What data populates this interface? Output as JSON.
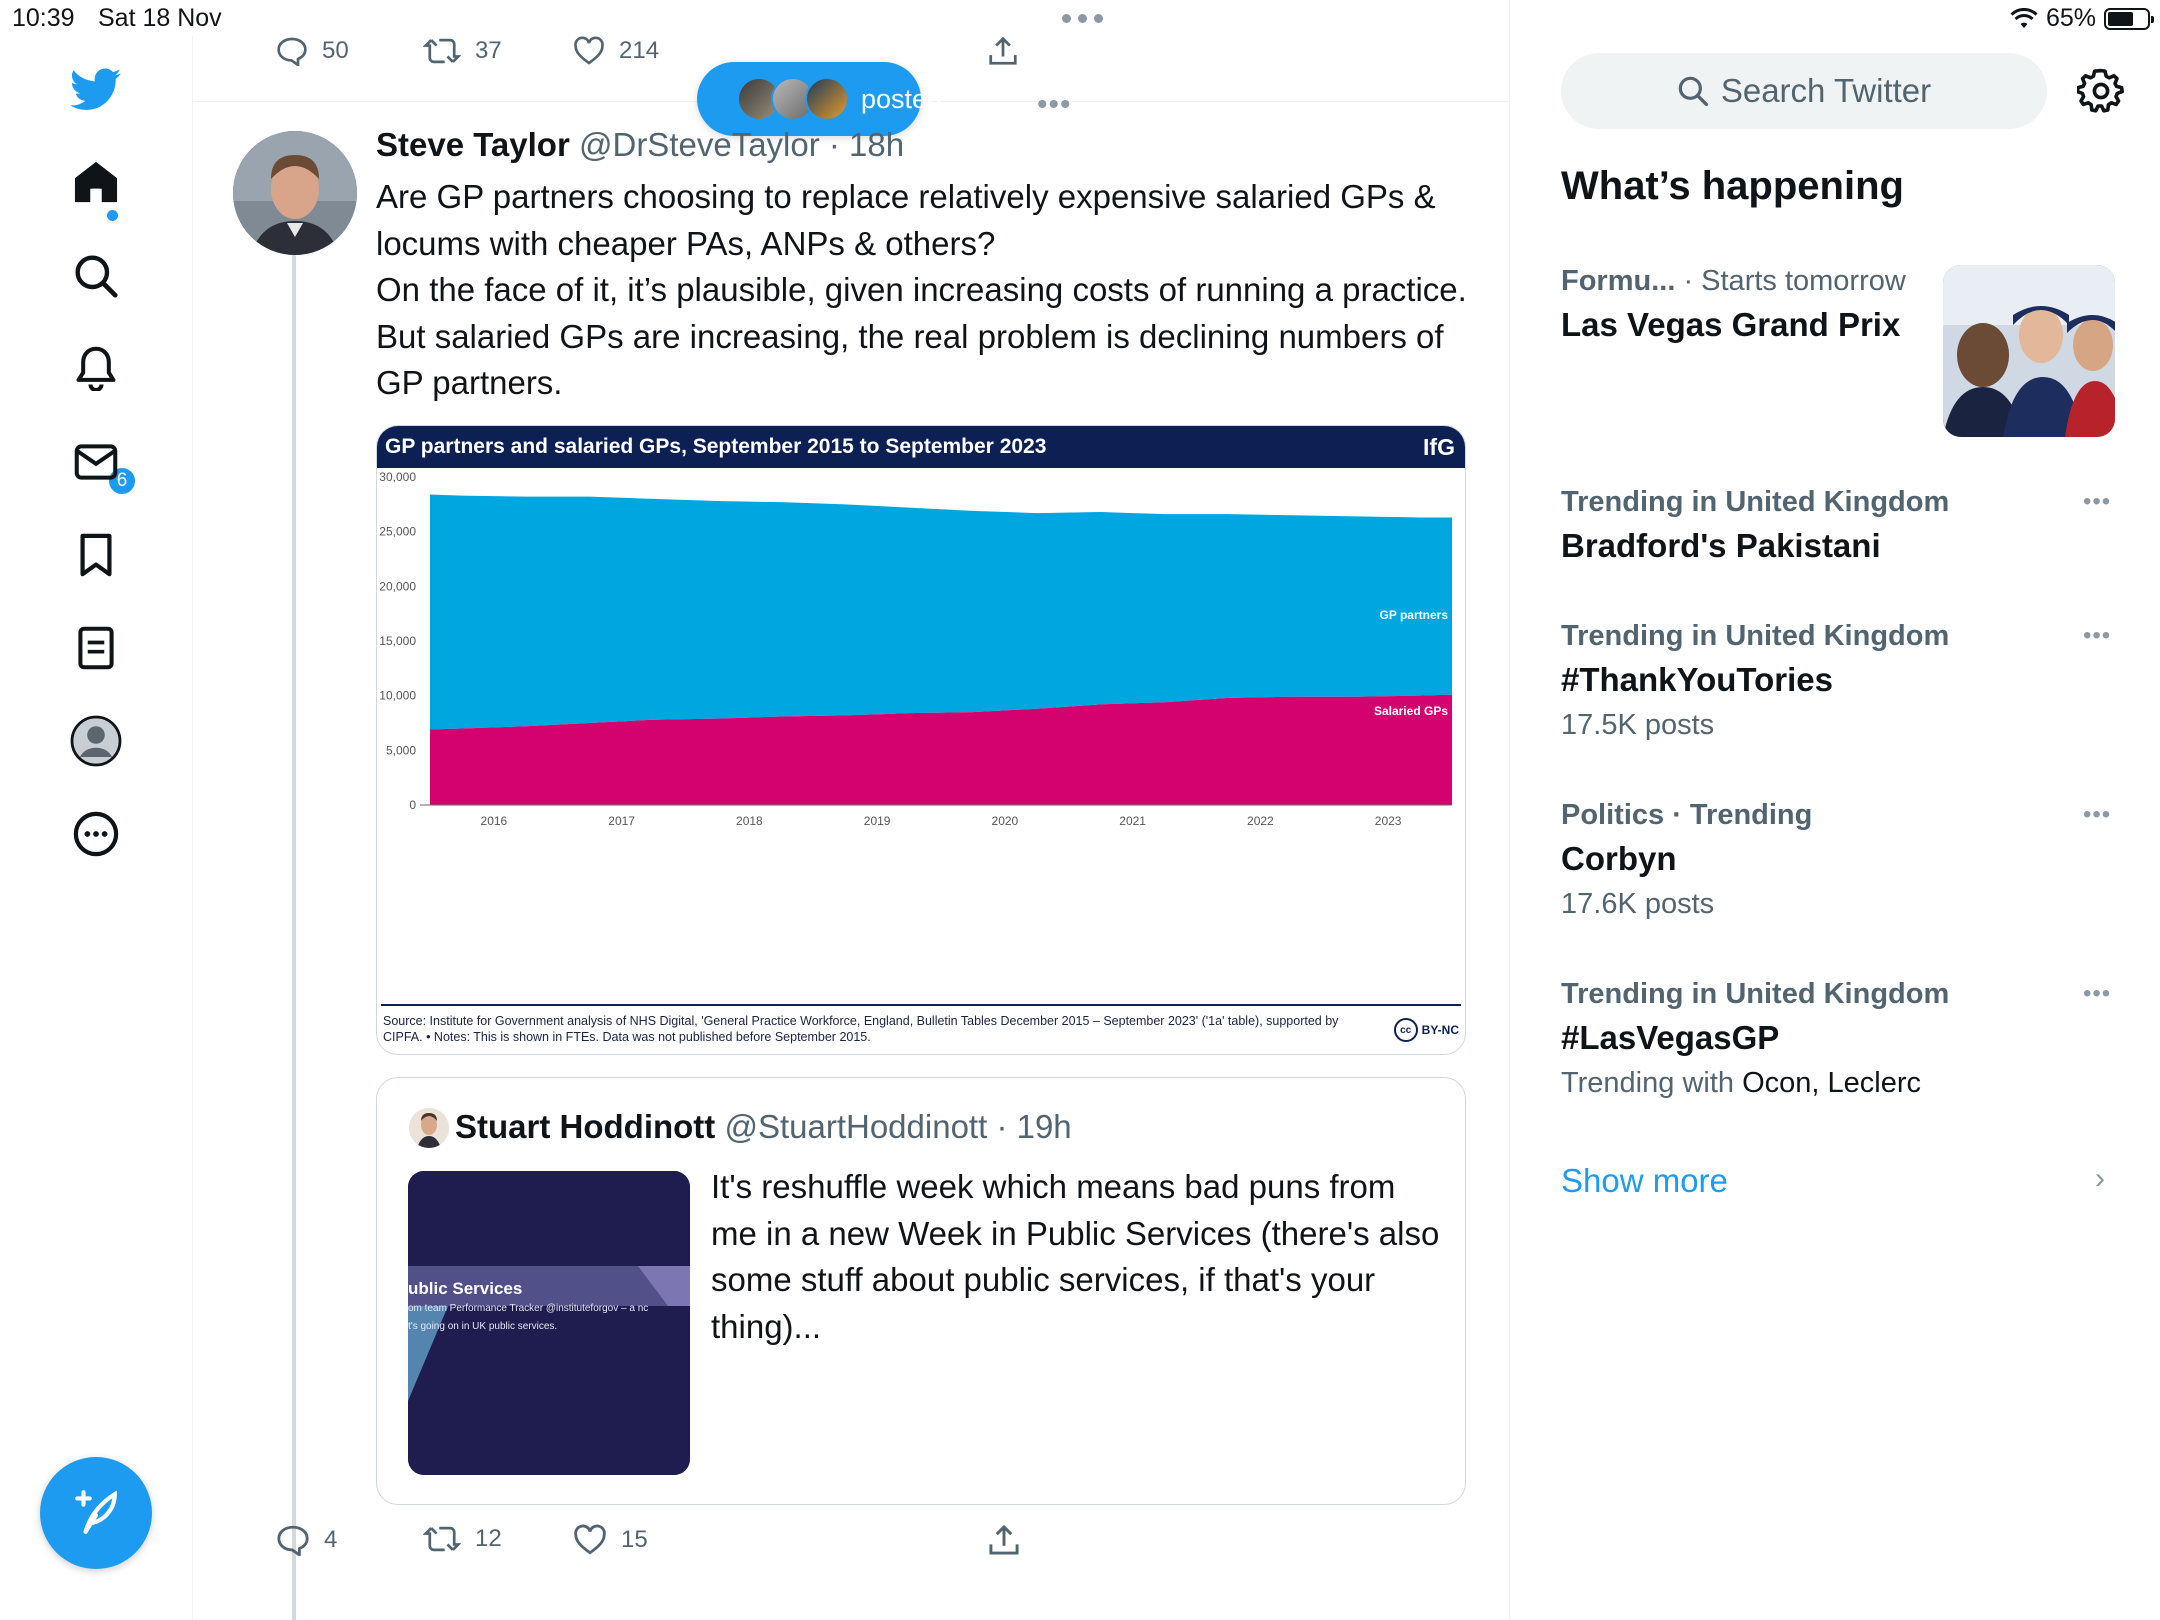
{
  "status": {
    "time": "10:39",
    "date": "Sat 18 Nov",
    "battery": "65%",
    "battery_level": 0.65
  },
  "sidebar": {
    "items": [
      {
        "id": "logo",
        "icon": "twitter-bird-icon"
      },
      {
        "id": "home",
        "icon": "home-icon"
      },
      {
        "id": "explore",
        "icon": "search-icon"
      },
      {
        "id": "notifications",
        "icon": "bell-icon",
        "badge": "6"
      },
      {
        "id": "messages",
        "icon": "mail-icon"
      },
      {
        "id": "bookmarks",
        "icon": "bookmark-icon"
      },
      {
        "id": "lists",
        "icon": "list-icon"
      },
      {
        "id": "profile",
        "icon": "profile-icon"
      },
      {
        "id": "more",
        "icon": "more-icon"
      }
    ],
    "compose_icon": "compose-feather-icon"
  },
  "prev_tweet": {
    "replies": "50",
    "retweets": "37",
    "likes": "214"
  },
  "posted_pill": {
    "label": "posted"
  },
  "tweet": {
    "name": "Steve Taylor",
    "handle": "@DrSteveTaylor",
    "time": "· 18h",
    "text_1": "Are GP partners choosing to replace relatively expensive salaried GPs & locums with cheaper PAs, ANPs & others?",
    "text_2": "On the face of it, it’s plausible, given increasing costs of running a practice. But salaried GPs are increasing, the real problem is declining numbers of GP partners.",
    "replies": "4",
    "retweets": "12",
    "likes": "15"
  },
  "chart": {
    "title": "GP partners and salaried GPs, September 2015 to September 2023",
    "logo": "IfG",
    "source": "Source: Institute for Government analysis of NHS Digital, 'General Practice Workforce, England, Bulletin Tables December 2015 – September 2023' ('1a' table), supported by CIPFA. • Notes: This is shown in FTEs. Data was not published before September 2015.",
    "license": "BY-NC",
    "cc": "cc"
  },
  "chart_data": {
    "type": "area",
    "title": "GP partners and salaried GPs, September 2015 to September 2023",
    "stacked": true,
    "x": [
      2015.75,
      2016.0,
      2016.5,
      2017.0,
      2017.5,
      2018.0,
      2018.5,
      2019.0,
      2019.5,
      2020.0,
      2020.5,
      2021.0,
      2021.5,
      2022.0,
      2022.5,
      2023.0,
      2023.5,
      2023.75
    ],
    "x_ticks": [
      "2016",
      "2017",
      "2018",
      "2019",
      "2020",
      "2021",
      "2022",
      "2023"
    ],
    "y_ticks": [
      "0",
      "5,000",
      "10,000",
      "15,000",
      "20,000",
      "25,000",
      "30,000"
    ],
    "ylim": [
      0,
      30000
    ],
    "series": [
      {
        "name": "Salaried GPs",
        "color": "#d4026e",
        "values": [
          6900,
          7000,
          7200,
          7500,
          7800,
          7900,
          8100,
          8200,
          8400,
          8500,
          8800,
          9200,
          9400,
          9800,
          9900,
          9900,
          10000,
          10100
        ]
      },
      {
        "name": "GP partners",
        "color": "#00a6e0",
        "values": [
          21500,
          21300,
          21000,
          20700,
          20200,
          19900,
          19600,
          19300,
          18800,
          18400,
          17900,
          17600,
          17200,
          16800,
          16600,
          16500,
          16300,
          16200
        ]
      }
    ],
    "grid": false
  },
  "quote": {
    "name": "Stuart Hoddinott",
    "handle": "@StuartHoddinott",
    "time": "· 19h",
    "text": "It's reshuffle week which means bad puns from me in a new Week in Public Services (there's also some stuff about public services, if that's your thing)...",
    "thumb_title": "ublic Services",
    "thumb_line1": "om team Performance Tracker @instituteforgov – a nc",
    "thumb_line2": "t's going on in UK public services."
  },
  "right": {
    "search_placeholder": "Search Twitter",
    "happening_title": "What’s happening",
    "trends": [
      {
        "meta_bold": "Formu...",
        "meta": " · Starts tomorrow",
        "title": "Las Vegas Grand Prix",
        "sub": ""
      },
      {
        "meta_bold": "Trending in United Kingdom",
        "meta": "",
        "title": "Bradford's Pakistani",
        "sub": ""
      },
      {
        "meta_bold": "Trending in United Kingdom",
        "meta": "",
        "title": "#ThankYouTories",
        "sub": "17.5K posts"
      },
      {
        "meta_bold": "Politics · Trending",
        "meta": "",
        "title": "Corbyn",
        "sub": "17.6K posts"
      },
      {
        "meta_bold": "Trending in United Kingdom",
        "meta": "",
        "title": "#LasVegasGP",
        "sub": "Trending with ",
        "sub_dark": "Ocon, Leclerc"
      }
    ],
    "show_more": "Show more"
  }
}
